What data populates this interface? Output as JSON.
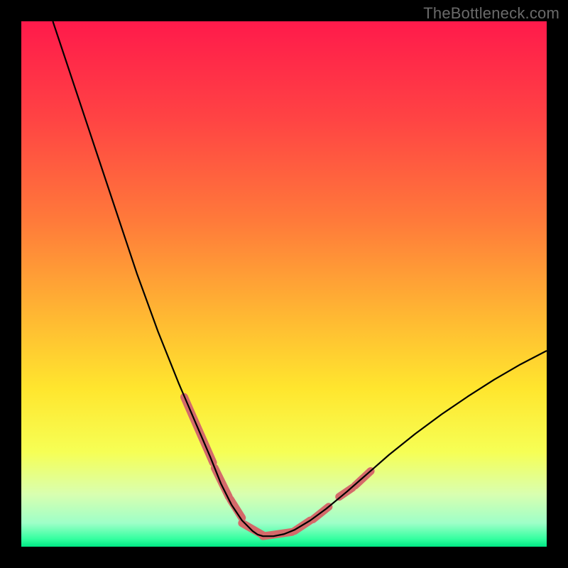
{
  "watermark": "TheBottleneck.com",
  "chart_data": {
    "type": "line",
    "title": "",
    "xlabel": "",
    "ylabel": "",
    "xlim": [
      0,
      100
    ],
    "ylim": [
      0,
      100
    ],
    "grid": false,
    "legend": false,
    "gradient_stops": [
      {
        "offset": 0,
        "color": "#ff1a4b"
      },
      {
        "offset": 0.18,
        "color": "#ff4244"
      },
      {
        "offset": 0.38,
        "color": "#ff7a3a"
      },
      {
        "offset": 0.55,
        "color": "#ffb433"
      },
      {
        "offset": 0.7,
        "color": "#ffe62e"
      },
      {
        "offset": 0.82,
        "color": "#f6ff55"
      },
      {
        "offset": 0.9,
        "color": "#d9ffb0"
      },
      {
        "offset": 0.955,
        "color": "#9effc8"
      },
      {
        "offset": 0.985,
        "color": "#35ffa0"
      },
      {
        "offset": 1.0,
        "color": "#00e884"
      }
    ],
    "series": [
      {
        "name": "bottleneck-curve",
        "stroke": "#000000",
        "stroke_width": 2.2,
        "x": [
          6,
          8,
          10,
          12,
          14,
          16,
          18,
          20,
          22,
          24,
          26,
          28,
          30,
          31.5,
          33,
          34.5,
          36,
          37,
          38,
          39,
          40,
          41,
          42,
          43,
          44,
          45,
          46,
          48,
          50,
          52,
          55,
          58,
          62,
          66,
          70,
          75,
          80,
          85,
          90,
          95,
          100
        ],
        "y": [
          100,
          94,
          88,
          82,
          76,
          70,
          64,
          58,
          52,
          46.5,
          41,
          36,
          31,
          27.5,
          24,
          20.5,
          17,
          14.5,
          12,
          10,
          8,
          6.5,
          5,
          4,
          3,
          2.3,
          2,
          2,
          2.4,
          3.2,
          5,
          7.2,
          10.5,
          14,
          17.5,
          21.5,
          25.2,
          28.6,
          31.8,
          34.7,
          37.3
        ]
      }
    ],
    "highlights": [
      {
        "name": "bottom-segments",
        "stroke": "#d46a6a",
        "stroke_width": 11,
        "linecap": "round",
        "segments": [
          {
            "x1": 31.0,
            "y1": 28.5,
            "x2": 36.5,
            "y2": 16.0
          },
          {
            "x1": 36.8,
            "y1": 15.0,
            "x2": 39.5,
            "y2": 9.5
          },
          {
            "x1": 39.8,
            "y1": 9.0,
            "x2": 42.0,
            "y2": 5.5
          },
          {
            "x1": 42.0,
            "y1": 4.5,
            "x2": 46.0,
            "y2": 2.2
          },
          {
            "x1": 46.0,
            "y1": 2.0,
            "x2": 51.5,
            "y2": 2.8
          },
          {
            "x1": 52.0,
            "y1": 3.0,
            "x2": 55.0,
            "y2": 5.0
          },
          {
            "x1": 55.5,
            "y1": 5.2,
            "x2": 58.5,
            "y2": 7.6
          },
          {
            "x1": 60.5,
            "y1": 9.5,
            "x2": 63.0,
            "y2": 11.2
          },
          {
            "x1": 63.5,
            "y1": 11.6,
            "x2": 66.5,
            "y2": 14.4
          }
        ]
      }
    ]
  }
}
